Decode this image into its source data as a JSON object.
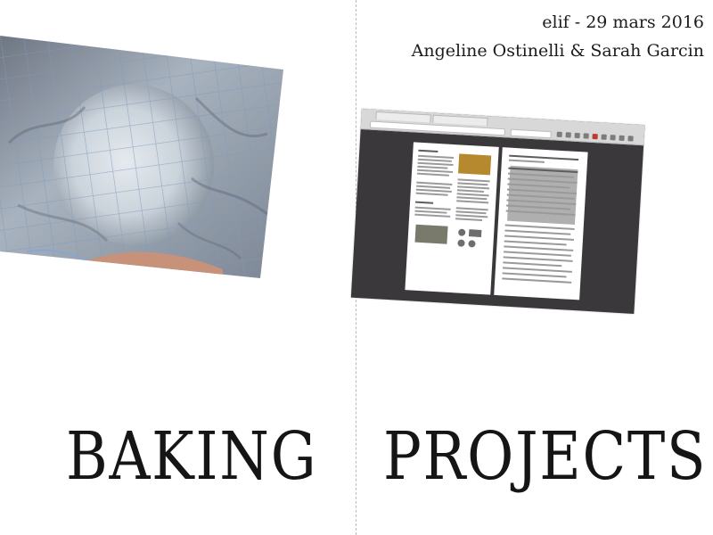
{
  "event": {
    "date_line": "elif - 29 mars 2016",
    "authors": "Angeline Ostinelli & Sarah Garcin"
  },
  "title": {
    "left_word": "BAKING",
    "right_word": "PROJECTS"
  },
  "images": {
    "left_photo": "dough-under-cloth-photo",
    "right_screenshot": "browser-screenshot"
  },
  "colors": {
    "background": "#ffffff",
    "text": "#151515",
    "divider": "#b9b9b9",
    "cloth": "#b7c3cf",
    "cloth_grid": "#8ea7c6",
    "browser_dark": "#3a383a"
  }
}
